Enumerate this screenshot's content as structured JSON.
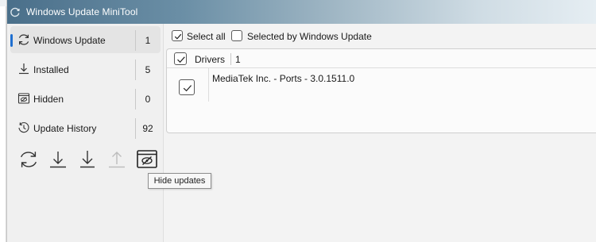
{
  "window": {
    "title": "Windows Update MiniTool"
  },
  "sidebar": {
    "items": [
      {
        "label": "Windows Update",
        "count": "1",
        "icon": "refresh-icon",
        "selected": true
      },
      {
        "label": "Installed",
        "count": "5",
        "icon": "download-icon",
        "selected": false
      },
      {
        "label": "Hidden",
        "count": "0",
        "icon": "hidden-eye-icon",
        "selected": false
      },
      {
        "label": "Update History",
        "count": "92",
        "icon": "history-icon",
        "selected": false
      }
    ],
    "toolbar": [
      {
        "icon": "check-updates-icon"
      },
      {
        "icon": "download-icon"
      },
      {
        "icon": "install-icon"
      },
      {
        "icon": "upload-icon",
        "disabled": true
      },
      {
        "icon": "hide-updates-icon"
      }
    ],
    "tooltip": "Hide updates"
  },
  "main": {
    "select_all_label": "Select all",
    "selected_by_wu_label": "Selected by Windows Update",
    "select_all_checked": true,
    "selected_by_wu_checked": false,
    "groups": [
      {
        "name": "Drivers",
        "count": "1",
        "checked": true,
        "updates": [
          {
            "name": "MediaTek Inc. - Ports - 3.0.1511.0",
            "checked": true
          }
        ]
      }
    ]
  },
  "colors": {
    "accent": "#1f6fd0",
    "titlebar_start": "#4a6f8a",
    "sidebar_bg": "#f0f0f0",
    "selected_bg": "#e4e4e4"
  }
}
